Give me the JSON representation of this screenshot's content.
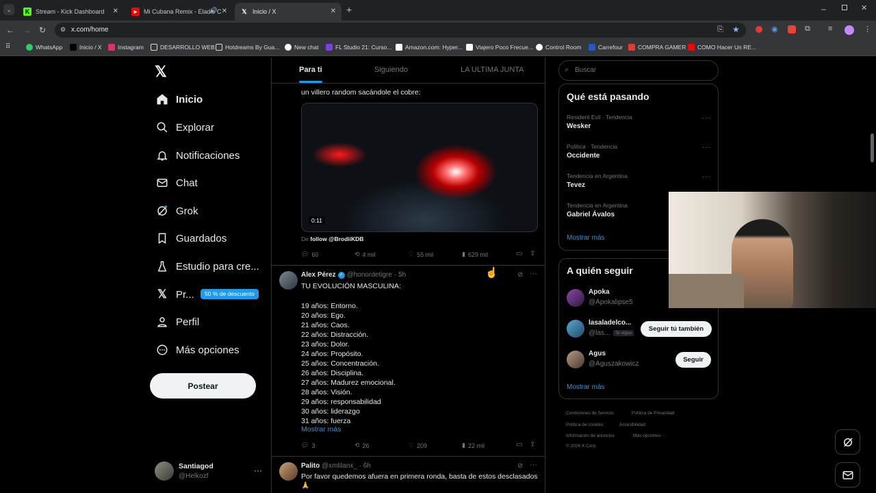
{
  "browser": {
    "tabs": [
      {
        "title": "Stream - Kick Dashboard",
        "icon": "kick-icon"
      },
      {
        "title": "Mi Cubana Remix - Eladio C",
        "icon": "youtube-icon"
      },
      {
        "title": "Inicio / X",
        "icon": "x-icon"
      }
    ],
    "url": "x.com/home",
    "bookmarks": [
      "WhatsApp",
      "Inicio / X",
      "Instagram",
      "DESARROLLO WEB",
      "Hotdreams By Gua...",
      "New chat",
      "FL Studio 21: Curso...",
      "Amazon.com: Hyper...",
      "Viajero Poco Frecue...",
      "Control Room",
      "Carrefour",
      "COMPRA GAMER",
      "COMO Hacer Un RE..."
    ]
  },
  "nav": {
    "items": [
      "Inicio",
      "Explorar",
      "Notificaciones",
      "Chat",
      "Grok",
      "Guardados",
      "Estudio para cre...",
      "Pr...",
      "Perfil",
      "Más opciones"
    ],
    "premium_badge": "50 % de descuento",
    "post_button": "Postear",
    "user": {
      "name": "Santiagod",
      "handle": "@Helkozf"
    }
  },
  "timeline": {
    "tabs": [
      "Para ti",
      "Siguiendo",
      "LA ULTIMA JUNTA"
    ],
    "post1": {
      "text": "un villero random sacándole el cobre:",
      "duration": "0:11",
      "source_prefix": "De",
      "source": "follow @BrodiiKDB",
      "replies": "60",
      "reposts": "4 mil",
      "likes": "55 mil",
      "views": "629 mil"
    },
    "post2": {
      "name": "Alex Pérez",
      "handle": "@honordetigre",
      "time": "· 5h",
      "title": "TU EVOLUCIÓN MASCULINA:",
      "lines": [
        "19 años: Entorno.",
        "20 años: Ego.",
        "21 años: Caos.",
        "22 años: Distracción.",
        "23 años: Dolor.",
        "24 años: Propósito.",
        "25 años: Concentración.",
        "26 años: Disciplina.",
        "27 años: Madurez emocional.",
        "28 años: Visión.",
        "29 años: responsabilidad",
        "30 años: liderazgo",
        "31 años: fuerza"
      ],
      "more": "Mostrar más",
      "replies": "3",
      "reposts": "26",
      "likes": "209",
      "views": "22 mil"
    },
    "post3": {
      "name": "Palito",
      "handle": "@xmlilanx_",
      "time": "· 6h",
      "text": "Por favor quedemos afuera en primera ronda, basta de estos desclasados"
    }
  },
  "sidebar": {
    "search_placeholder": "Buscar",
    "trends_title": "Qué está pasando",
    "trends": [
      {
        "meta": "Resident Evil · Tendencia",
        "name": "Wesker"
      },
      {
        "meta": "Política · Tendencia",
        "name": "Occidente"
      },
      {
        "meta": "Tendencia en Argentina",
        "name": "Tevez"
      },
      {
        "meta": "Tendencia en Argentina",
        "name": "Gabriel Ávalos"
      }
    ],
    "trends_more": "Mostrar más",
    "follow_title": "A quién seguir",
    "follow": [
      {
        "name": "Apoka",
        "handle": "@Apokalipse5",
        "button": ""
      },
      {
        "name": "lasaladelco...",
        "handle": "@las...",
        "badge": "Te sigue",
        "button": "Seguir tú también"
      },
      {
        "name": "Agus",
        "handle": "@Aguszakowicz",
        "button": "Seguir"
      }
    ],
    "follow_more": "Mostrar más",
    "footer": [
      "Condiciones de Servicio",
      "Política de Privacidad",
      "Política de cookies",
      "Accesibilidad",
      "Información de anuncios",
      "Más opciones ···",
      "© 2026 X Corp."
    ]
  },
  "colors": {
    "accent": "#1d9bf0",
    "bg": "#000000",
    "border": "#2f3336",
    "muted": "#71767b"
  }
}
